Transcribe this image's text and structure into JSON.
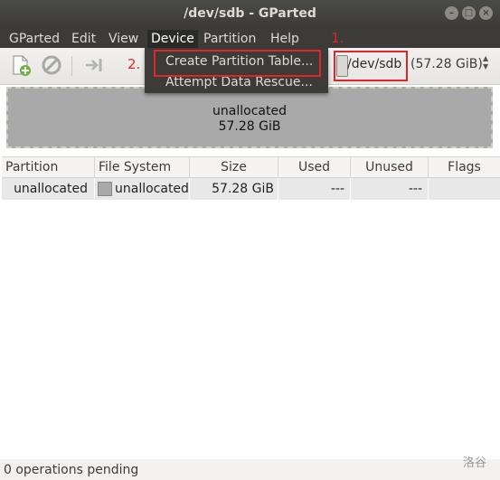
{
  "window": {
    "title": "/dev/sdb - GParted",
    "controls": [
      "–",
      "□",
      "×"
    ]
  },
  "menubar": {
    "items": [
      "GParted",
      "Edit",
      "View",
      "Device",
      "Partition",
      "Help"
    ],
    "active": "Device"
  },
  "device_menu": {
    "items": [
      "Create Partition Table...",
      "Attempt Data Rescue..."
    ],
    "highlighted": "Create Partition Table..."
  },
  "toolbar": {
    "icons": [
      "new-partition-icon",
      "delete-icon",
      "resize-icon"
    ]
  },
  "device_selector": {
    "device": "/dev/sdb",
    "size": "(57.28 GiB)"
  },
  "annotations": {
    "step1": "1.",
    "step2": "2."
  },
  "disk_map": {
    "label": "unallocated",
    "size": "57.28 GiB"
  },
  "table": {
    "columns": [
      "Partition",
      "File System",
      "Size",
      "Used",
      "Unused",
      "Flags"
    ],
    "rows": [
      {
        "partition": "unallocated",
        "file_system": "unallocated",
        "size": "57.28 GiB",
        "used": "---",
        "unused": "---",
        "flags": ""
      }
    ]
  },
  "status": {
    "text": "0 operations pending"
  },
  "watermark": {
    "text": "洛谷"
  },
  "colors": {
    "accent_red": "#e0252b",
    "menubar": "#3c3b37",
    "unallocated": "#a9a9a9"
  }
}
